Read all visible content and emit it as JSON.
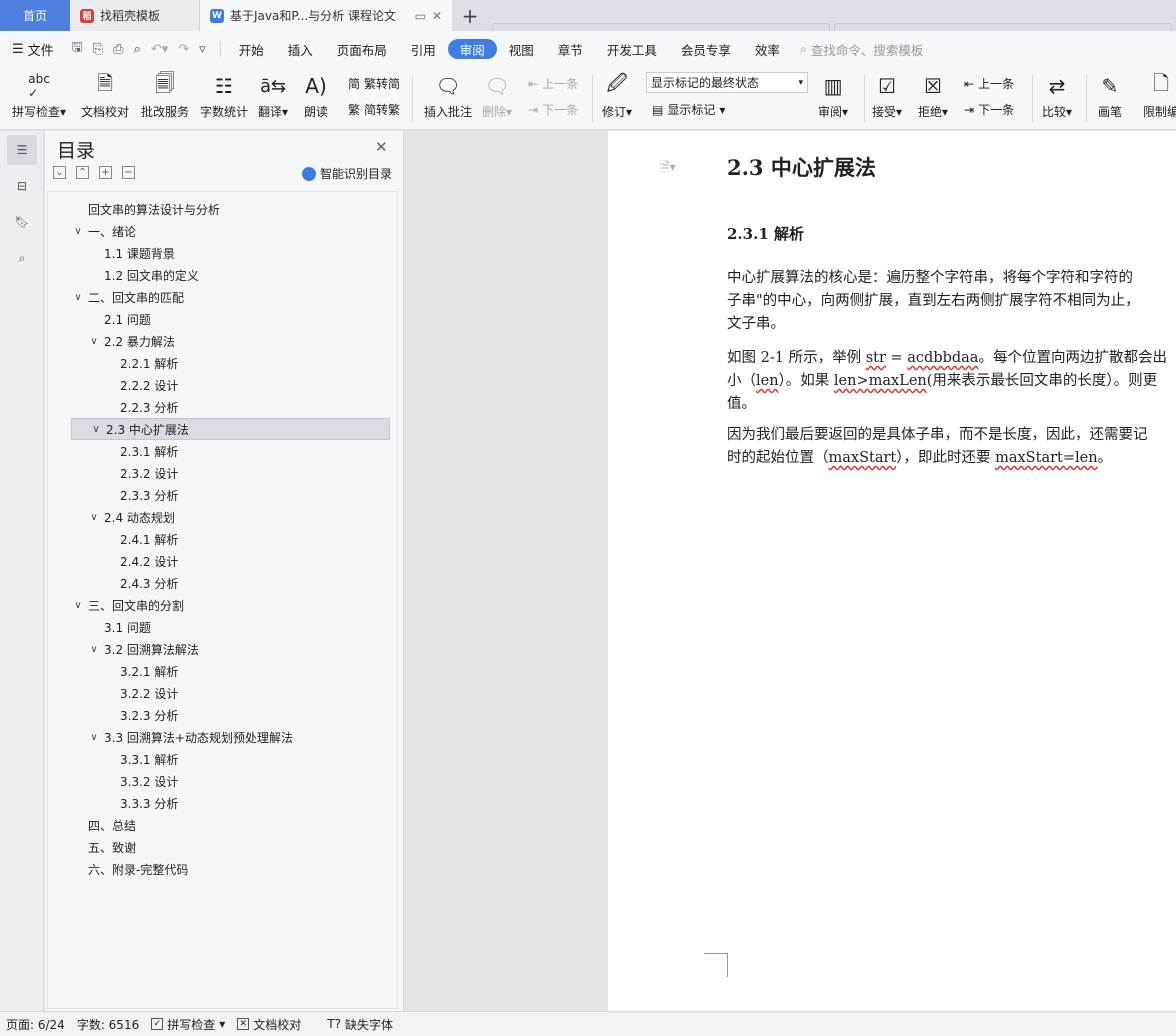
{
  "tabs": {
    "home": "首页",
    "template_tab": "找稻壳模板",
    "doc_tab": "基于Java和P...与分析 课程论文"
  },
  "menubar": {
    "file": "文件",
    "items": [
      "开始",
      "插入",
      "页面布局",
      "引用",
      "审阅",
      "视图",
      "章节",
      "开发工具",
      "会员专享",
      "效率"
    ],
    "active": "审阅",
    "search": "查找命令、搜索模板"
  },
  "ribbon": {
    "spell_check": "拼写检查",
    "doc_proof": "文档校对",
    "correction_service": "批改服务",
    "word_count": "字数统计",
    "translate": "翻译",
    "read_aloud": "朗读",
    "trad_conv": "繁转简",
    "simp_conv": "简转繁",
    "insert_comment": "插入批注",
    "delete": "删除",
    "prev_comment": "上一条",
    "next_comment": "下一条",
    "track_changes": "修订",
    "display_state": "显示标记的最终状态",
    "show_markup": "显示标记",
    "review": "审阅",
    "accept": "接受",
    "reject": "拒绝",
    "prev_change": "上一条",
    "next_change": "下一条",
    "compare": "比较",
    "pen": "画笔",
    "restrict": "限制编"
  },
  "toc": {
    "title": "目录",
    "smart": "智能识别目录",
    "items": [
      {
        "text": "回文串的算法设计与分析",
        "level": 0,
        "chev": false
      },
      {
        "text": "一、绪论",
        "level": 0,
        "chev": true
      },
      {
        "text": "1.1  课题背景",
        "level": 1,
        "chev": false
      },
      {
        "text": "1.2  回文串的定义",
        "level": 1,
        "chev": false
      },
      {
        "text": "二、回文串的匹配",
        "level": 0,
        "chev": true
      },
      {
        "text": "2.1  问题",
        "level": 1,
        "chev": false
      },
      {
        "text": "2.2  暴力解法",
        "level": 1,
        "chev": true
      },
      {
        "text": "2.2.1  解析",
        "level": 2,
        "chev": false
      },
      {
        "text": "2.2.2  设计",
        "level": 2,
        "chev": false
      },
      {
        "text": "2.2.3  分析",
        "level": 2,
        "chev": false
      },
      {
        "text": "2.3  中心扩展法",
        "level": 1,
        "chev": true
      },
      {
        "text": "2.3.1  解析",
        "level": 2,
        "chev": false
      },
      {
        "text": "2.3.2  设计",
        "level": 2,
        "chev": false
      },
      {
        "text": "2.3.3  分析",
        "level": 2,
        "chev": false
      },
      {
        "text": "2.4  动态规划",
        "level": 1,
        "chev": true
      },
      {
        "text": "2.4.1  解析",
        "level": 2,
        "chev": false
      },
      {
        "text": "2.4.2  设计",
        "level": 2,
        "chev": false
      },
      {
        "text": "2.4.3  分析",
        "level": 2,
        "chev": false
      },
      {
        "text": "三、回文串的分割",
        "level": 0,
        "chev": true
      },
      {
        "text": "3.1  问题",
        "level": 1,
        "chev": false
      },
      {
        "text": "3.2  回溯算法解法",
        "level": 1,
        "chev": true
      },
      {
        "text": "3.2.1  解析",
        "level": 2,
        "chev": false
      },
      {
        "text": "3.2.2  设计",
        "level": 2,
        "chev": false
      },
      {
        "text": "3.2.3  分析",
        "level": 2,
        "chev": false
      },
      {
        "text": "3.3  回溯算法+动态规划预处理解法",
        "level": 1,
        "chev": true
      },
      {
        "text": "3.3.1  解析",
        "level": 2,
        "chev": false
      },
      {
        "text": "3.3.2  设计",
        "level": 2,
        "chev": false
      },
      {
        "text": "3.3.3  分析",
        "level": 2,
        "chev": false
      },
      {
        "text": "四、总结",
        "level": 0,
        "chev": false
      },
      {
        "text": "五、致谢",
        "level": 0,
        "chev": false
      },
      {
        "text": "六、附录-完整代码",
        "level": 0,
        "chev": false
      }
    ],
    "selected_index": 10
  },
  "document": {
    "heading2": "2.3  中心扩展法",
    "heading3": "2.3.1  解析",
    "p1": [
      "中心扩展算法的核心是：遍历整个字符串，将每个字符和字符的",
      "子串\"的中心，向两侧扩展，直到左右两侧扩展字符不相同为止，",
      "文子串。"
    ],
    "p2_line1_a": "如图 2-1  所示，举例 ",
    "p2_line1_b": "str",
    "p2_line1_c": " = ",
    "p2_line1_d": "acdbbdaa",
    "p2_line1_e": "。每个位置向两边扩散都会出",
    "p2_line2_a": "小（",
    "p2_line2_b": "len",
    "p2_line2_c": "）。如果  ",
    "p2_line2_d": "len>maxLen",
    "p2_line2_e": "(用来表示最长回文串的长度）。则更",
    "p2_line3": "值。",
    "p3_line1": "因为我们最后要返回的是具体子串，而不是长度，因此，还需要记",
    "p3_line2_a": "时的起始位置（",
    "p3_line2_b": "maxStart",
    "p3_line2_c": "），即此时还要 ",
    "p3_line2_d": "maxStart=len",
    "p3_line2_e": "。"
  },
  "status": {
    "page": "页面: 6/24",
    "words": "字数: 6516",
    "spell": "拼写检查",
    "proof": "文档校对",
    "missing_font": "缺失字体"
  }
}
